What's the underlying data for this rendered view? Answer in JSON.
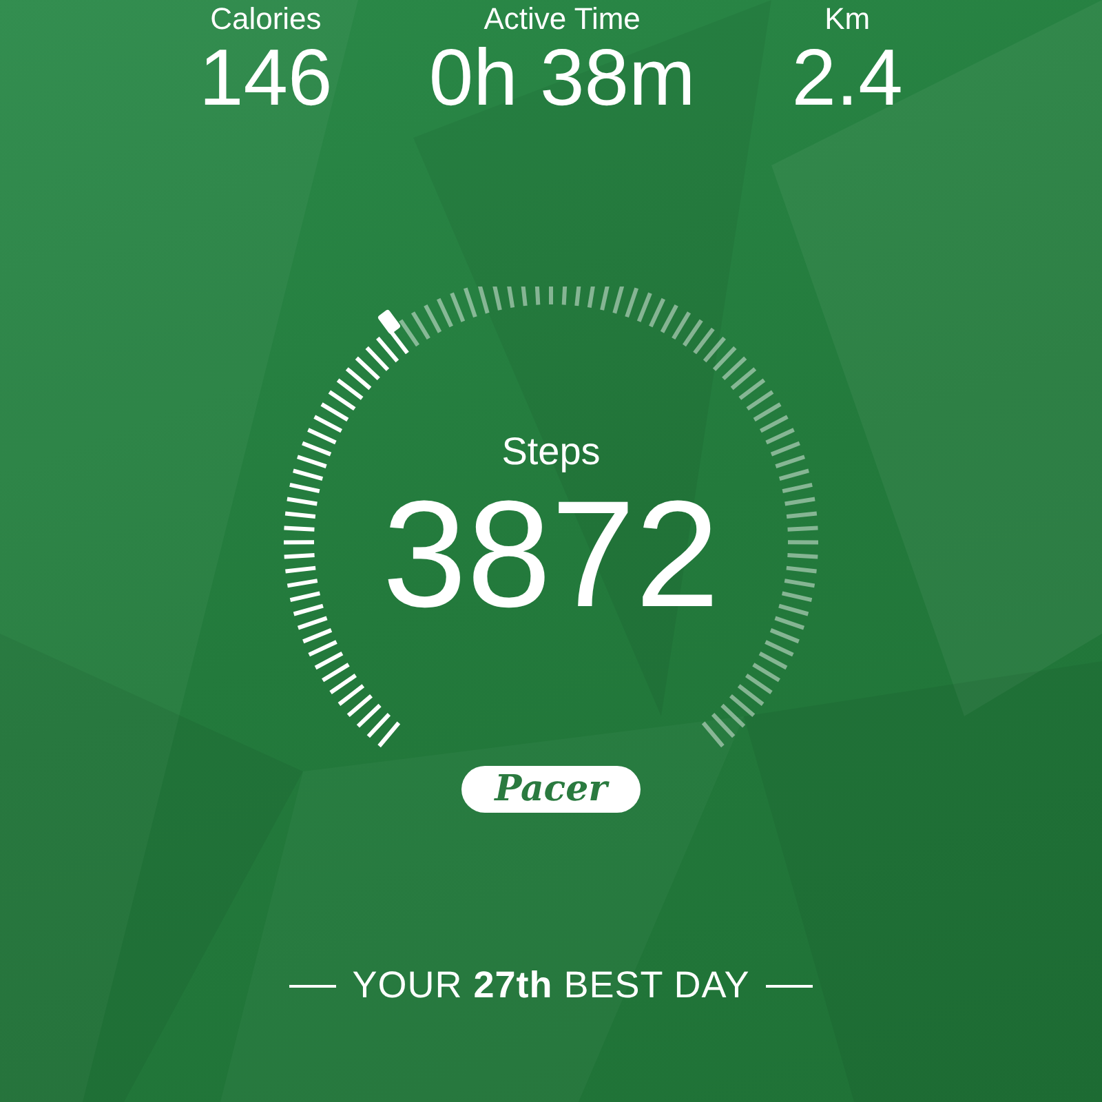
{
  "stats": [
    {
      "label": "Calories",
      "value": "146"
    },
    {
      "label": "Active Time",
      "value": "0h 38m"
    },
    {
      "label": "Km",
      "value": "2.4"
    }
  ],
  "steps": {
    "label": "Steps",
    "value": "3872"
  },
  "logo": "Pacer",
  "rank": "YOUR **27th** BEST DAY"
}
